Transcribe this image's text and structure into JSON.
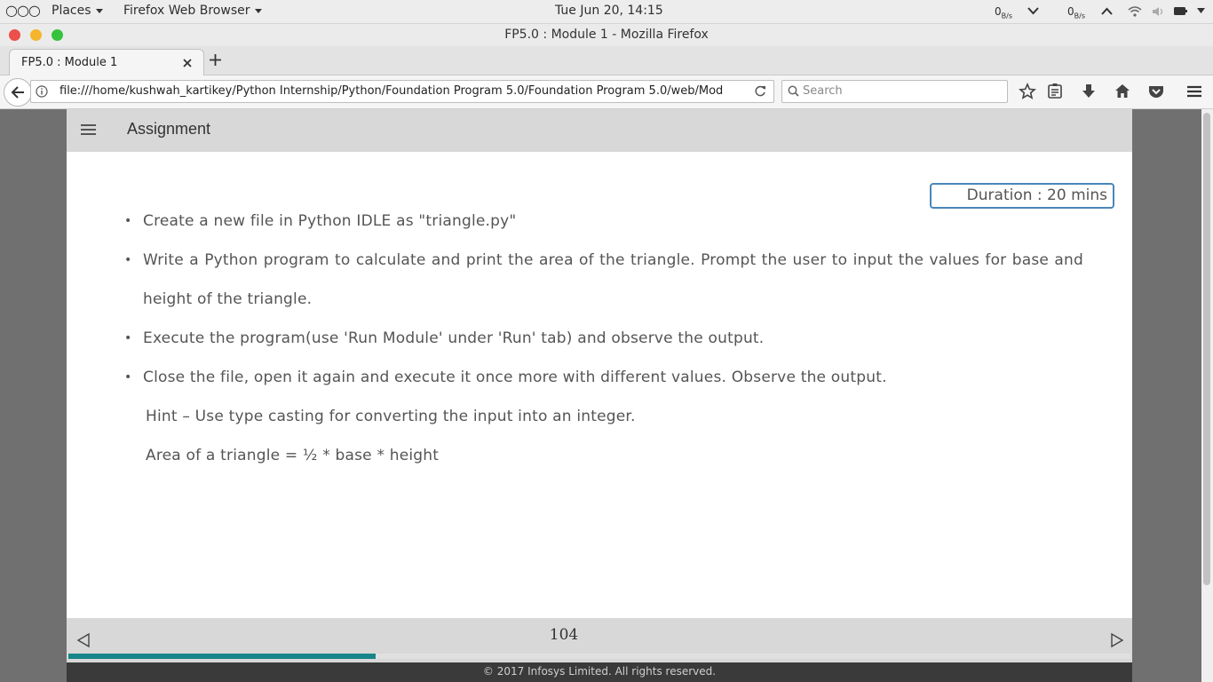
{
  "system_bar": {
    "places": "Places",
    "app": "Firefox Web Browser",
    "clock": "Tue Jun 20, 14:15",
    "net_down": "0",
    "net_down_unit": "B/s",
    "net_up": "0",
    "net_up_unit": "B/s"
  },
  "window": {
    "title": "FP5.0 : Module 1 - Mozilla Firefox"
  },
  "tabs": [
    {
      "label": "FP5.0 : Module 1"
    }
  ],
  "navbar": {
    "url": "file:///home/kushwah_kartikey/Python Internship/Python/Foundation Program 5.0/Foundation Program 5.0/web/Mod",
    "search_placeholder": "Search"
  },
  "app": {
    "title": "Assignment",
    "duration": "Duration : 20 mins",
    "bullets": [
      "Create a new file in Python IDLE as \"triangle.py\"",
      "Write a Python program to calculate and print the area of the triangle. Prompt the user to input   the values for base and height of the triangle.",
      "Execute the program(use 'Run Module' under 'Run' tab) and observe the output.",
      "Close the file, open it again and execute it once more with different values. Observe the output."
    ],
    "hint": "Hint – Use type casting for converting the input into an integer.",
    "formula": "Area of a triangle = ½ * base * height",
    "page_number": "104",
    "progress_fraction": 0.289,
    "copyright": "© 2017 Infosys Limited. All rights reserved."
  },
  "colors": {
    "progress": "#17858a",
    "duration_border": "#4a86b8",
    "close_dot": "#ed4f4a",
    "minimize_dot": "#f5b52c",
    "maximize_dot": "#37c23e"
  }
}
